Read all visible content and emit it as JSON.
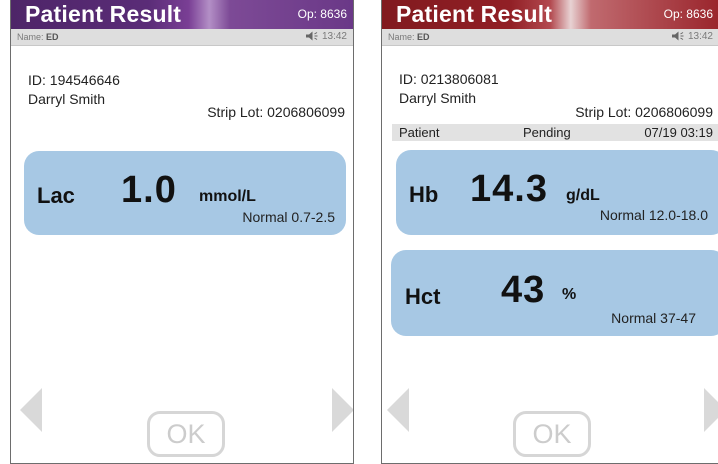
{
  "left": {
    "title": "Patient Result",
    "operator": "Op: 8636",
    "name_label": "Name:",
    "name_value": "ED",
    "time": "13:42",
    "patient_id": "ID: 194546646",
    "patient_name": "Darryl Smith",
    "strip_lot": "Strip Lot: 0206806099",
    "results": [
      {
        "analyte": "Lac",
        "value": "1.0",
        "unit": "mmol/L",
        "range": "Normal 0.7-2.5"
      }
    ],
    "ok_label": "OK",
    "colors": {
      "title_bar": "#5a2c77",
      "card": "#a7c8e4"
    }
  },
  "right": {
    "title": "Patient Result",
    "operator": "Op: 8636",
    "name_label": "Name:",
    "name_value": "ED",
    "time": "13:42",
    "patient_id": "ID: 0213806081",
    "patient_name": "Darryl Smith",
    "strip_lot": "Strip Lot: 0206806099",
    "status": {
      "type": "Patient",
      "state": "Pending",
      "datetime": "07/19  03:19"
    },
    "results": [
      {
        "analyte": "Hb",
        "value": "14.3",
        "unit": "g/dL",
        "range": "Normal 12.0-18.0"
      },
      {
        "analyte": "Hct",
        "value": "43",
        "unit": "%",
        "range": "Normal 37-47"
      }
    ],
    "ok_label": "OK",
    "colors": {
      "title_bar": "#911f25",
      "card": "#a7c8e4"
    }
  },
  "icons": {
    "speaker": "speaker-icon",
    "prev": "left-arrow-icon",
    "next": "right-arrow-icon"
  }
}
